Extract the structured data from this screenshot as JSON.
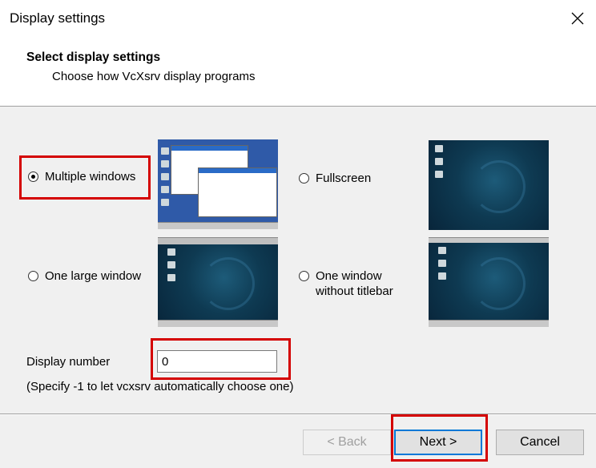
{
  "window": {
    "title": "Display settings"
  },
  "header": {
    "title": "Select display settings",
    "subtitle": "Choose how VcXsrv display programs"
  },
  "options": {
    "multiple_windows": {
      "label": "Multiple windows",
      "selected": true
    },
    "fullscreen": {
      "label": "Fullscreen",
      "selected": false
    },
    "one_large_window": {
      "label": "One large window",
      "selected": false
    },
    "one_window_no_titlebar": {
      "label_line1": "One window",
      "label_line2": "without titlebar",
      "selected": false
    }
  },
  "display_number": {
    "label": "Display number",
    "value": "0",
    "hint": "(Specify -1 to let vcxsrv automatically choose one)"
  },
  "buttons": {
    "back": "< Back",
    "next": "Next >",
    "cancel": "Cancel"
  },
  "colors": {
    "highlight": "#d40000",
    "desktop": "#0e3a52",
    "windows_desktop": "#2f5aa8"
  }
}
